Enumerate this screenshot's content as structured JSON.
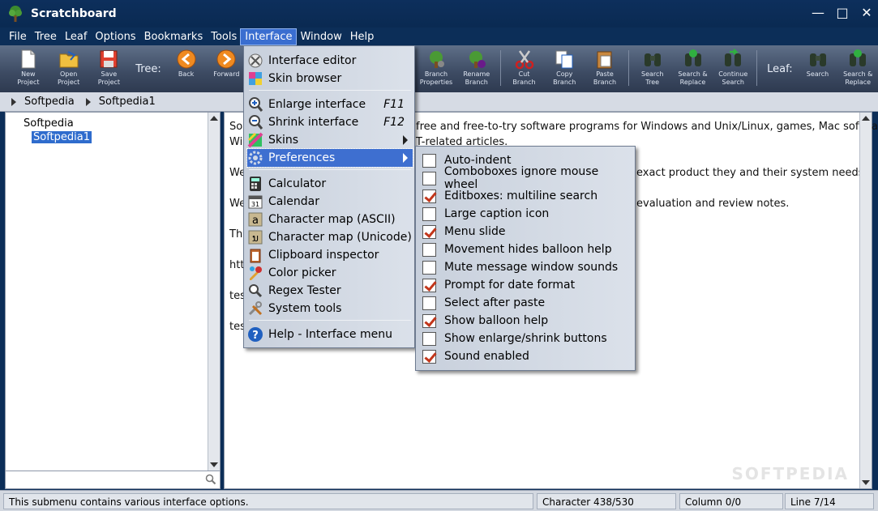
{
  "window": {
    "title": "Scratchboard"
  },
  "menubar": [
    "File",
    "Tree",
    "Leaf",
    "Options",
    "Bookmarks",
    "Tools",
    "Interface",
    "Window",
    "Help"
  ],
  "toolbar": {
    "project_buttons": [
      {
        "label": "New\nProject",
        "icon": "new-file-icon"
      },
      {
        "label": "Open\nProject",
        "icon": "open-folder-icon"
      },
      {
        "label": "Save\nProject",
        "icon": "save-disk-icon"
      }
    ],
    "tree_label": "Tree:",
    "nav_buttons": [
      {
        "label": "Back",
        "icon": "back-arrow-icon"
      },
      {
        "label": "Forward",
        "icon": "forward-arrow-icon"
      }
    ],
    "branch_buttons": [
      {
        "label": "Branch\nProperties",
        "icon": "branch-properties-icon"
      },
      {
        "label": "Rename\nBranch",
        "icon": "rename-branch-icon"
      },
      {
        "label": "Cut\nBranch",
        "icon": "scissors-icon"
      },
      {
        "label": "Copy\nBranch",
        "icon": "copy-icon"
      },
      {
        "label": "Paste\nBranch",
        "icon": "paste-icon"
      },
      {
        "label": "Search\nTree",
        "icon": "binoculars-icon"
      },
      {
        "label": "Search &\nReplace",
        "icon": "binoculars-replace-icon"
      },
      {
        "label": "Continue\nSearch",
        "icon": "binoculars-continue-icon"
      }
    ],
    "leaf_label": "Leaf:",
    "leaf_buttons": [
      {
        "label": "Search",
        "icon": "binoculars-icon"
      },
      {
        "label": "Search &\nReplace",
        "icon": "binoculars-replace-icon"
      }
    ]
  },
  "breadcrumb": [
    "Softpedia",
    "Softpedia1"
  ],
  "tree": {
    "root": "Softpedia",
    "child": "Softpedia1"
  },
  "editor": {
    "left_fragments": [
      "So",
      "Wi",
      "We",
      "We",
      "Thi",
      "htt",
      "tes",
      "tes"
    ],
    "right_fragments": [
      "free and free-to-try software programs for Windows and Unix/Linux, games, Mac software,",
      "T-related articles.",
      "exact product they and their system needs.",
      "evaluation and review notes."
    ],
    "watermark": "SOFTPEDIA"
  },
  "status": {
    "message": "This submenu contains various interface options.",
    "character": "Character 438/530",
    "column": "Column 0/0",
    "line": "Line 7/14"
  },
  "interface_menu": {
    "items": [
      {
        "label": "Interface editor",
        "icon": "interface-editor-icon"
      },
      {
        "label": "Skin browser",
        "icon": "skin-browser-icon"
      },
      {
        "label": "Enlarge interface",
        "shortcut": "F11",
        "icon": "zoom-in-icon"
      },
      {
        "label": "Shrink interface",
        "shortcut": "F12",
        "icon": "zoom-out-icon"
      },
      {
        "label": "Skins",
        "icon": "skins-icon",
        "submenu": true
      },
      {
        "label": "Preferences",
        "icon": "preferences-gear-icon",
        "submenu": true
      },
      {
        "label": "Calculator",
        "icon": "calculator-icon"
      },
      {
        "label": "Calendar",
        "icon": "calendar-icon"
      },
      {
        "label": "Character map (ASCII)",
        "icon": "charmap-ascii-icon"
      },
      {
        "label": "Character map (Unicode)",
        "icon": "charmap-unicode-icon"
      },
      {
        "label": "Clipboard inspector",
        "icon": "clipboard-icon"
      },
      {
        "label": "Color picker",
        "icon": "color-picker-icon"
      },
      {
        "label": "Regex Tester",
        "icon": "regex-tester-icon"
      },
      {
        "label": "System tools",
        "icon": "system-tools-icon"
      },
      {
        "label": "Help - Interface menu",
        "icon": "help-icon"
      }
    ]
  },
  "preferences_menu": {
    "items": [
      {
        "label": "Auto-indent",
        "checked": false
      },
      {
        "label": "Comboboxes ignore mouse wheel",
        "checked": false
      },
      {
        "label": "Editboxes: multiline search",
        "checked": true
      },
      {
        "label": "Large caption icon",
        "checked": false
      },
      {
        "label": "Menu slide",
        "checked": true
      },
      {
        "label": "Movement hides balloon help",
        "checked": false
      },
      {
        "label": "Mute message window sounds",
        "checked": false
      },
      {
        "label": "Prompt for date format",
        "checked": true
      },
      {
        "label": "Select after paste",
        "checked": false
      },
      {
        "label": "Show balloon help",
        "checked": true
      },
      {
        "label": "Show enlarge/shrink buttons",
        "checked": false
      },
      {
        "label": "Sound enabled",
        "checked": true
      }
    ]
  },
  "colors": {
    "title_bg": "#0d2f5c",
    "highlight": "#3e6fd0",
    "check": "#c2361b"
  }
}
